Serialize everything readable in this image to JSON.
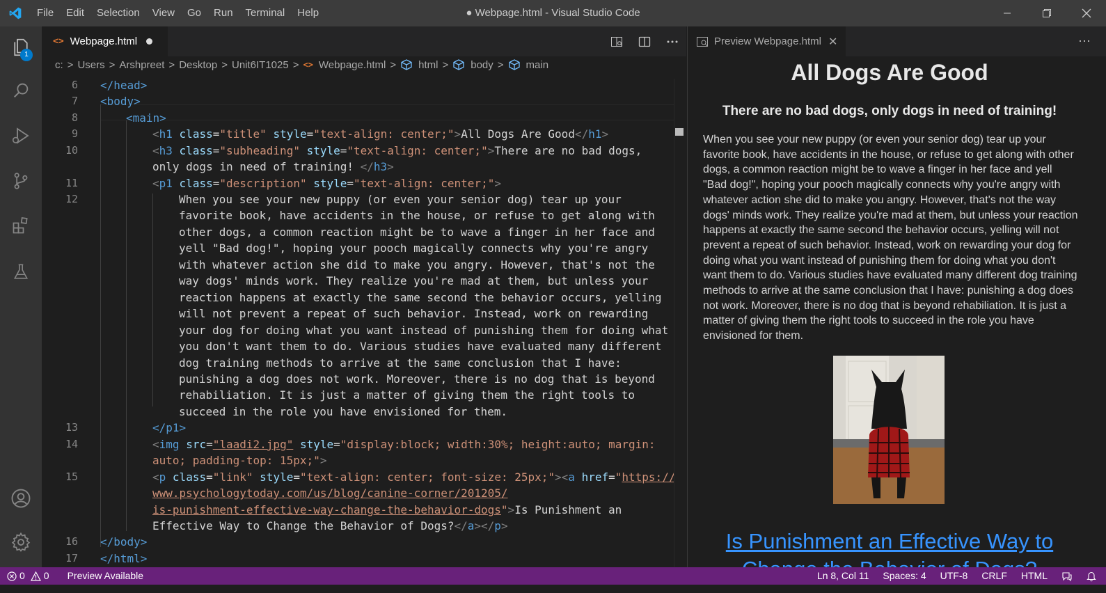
{
  "titlebar": {
    "menu": [
      "File",
      "Edit",
      "Selection",
      "View",
      "Go",
      "Run",
      "Terminal",
      "Help"
    ],
    "window_title": "● Webpage.html - Visual Studio Code"
  },
  "activity_bar": {
    "explorer_badge": "1"
  },
  "editor": {
    "tab_label": "Webpage.html",
    "breadcrumb": [
      "c:",
      "Users",
      "Arshpreet",
      "Desktop",
      "Unit6IT1025",
      "Webpage.html",
      "html",
      "body",
      "main"
    ],
    "line_numbers": [
      "6",
      "7",
      "8",
      "9",
      "10",
      "11",
      "12",
      "13",
      "14",
      "15",
      "16",
      "17"
    ],
    "code": {
      "l6_head_close": "</head>",
      "l7_body_open": "<body>",
      "l8_main_open": "<main>",
      "h1_class_val": "\"title\"",
      "h1_style_val": "\"text-align: center;\"",
      "h1_text": "All Dogs Are Good",
      "h3_class_val": "\"subheading\"",
      "h3_style_val": "\"text-align: center;\"",
      "h3_text_1": "There are no bad dogs,",
      "h3_text_2": "only dogs in need of training! ",
      "p1_class_val": "\"description\"",
      "p1_style_val": "\"text-align: center;\"",
      "desc_lines": [
        "When you see your new puppy (or even your senior dog) tear up your",
        "favorite book, have accidents in the house, or refuse to get along with",
        "other dogs, a common reaction might be to wave a finger in her face and",
        "yell \"Bad dog!\", hoping your pooch magically connects why you're angry",
        "with whatever action she did to make you angry. However, that's not the",
        "way dogs' minds work. They realize you're mad at them, but unless your",
        "reaction happens at exactly the same second the behavior occurs, yelling",
        "will not prevent a repeat of such behavior. Instead, work on rewarding",
        "your dog for doing what you want instead of punishing them for doing what",
        "you don't want them to do. Various studies have evaluated many different",
        "dog training methods to arrive at the same conclusion that I have:",
        "punishing a dog does not work. Moreover, there is no dog that is beyond",
        "rehabiliation. It is just a matter of giving them the right tools to",
        "succeed in the role you have envisioned for them."
      ],
      "p1_close": "</p1>",
      "img_src_val": "\"laadi2.jpg\"",
      "img_style_val_1": "\"display:block; width:30%; height:auto; margin:",
      "img_style_val_2": "auto; padding-top: 15px;\"",
      "p_class_val": "\"link\"",
      "p_style_val": "\"text-align: center; font-size: 25px;\"",
      "href_1": "https://",
      "href_2": "www.psychologytoday.com/us/blog/canine-corner/201205/",
      "href_3": "is-punishment-effective-way-change-the-behavior-dogs",
      "link_text_1": "Is Punishment an",
      "link_text_2": "Effective Way to Change the Behavior of Dogs?",
      "l16_body_close": "</body>",
      "l17_html_close": "</html>"
    }
  },
  "preview": {
    "tab_label": "Preview Webpage.html",
    "title": "All Dogs Are Good",
    "subheading": "There are no bad dogs, only dogs in need of training!",
    "description": "When you see your new puppy (or even your senior dog) tear up your favorite book, have accidents in the house, or refuse to get along with other dogs, a common reaction might be to wave a finger in her face and yell \"Bad dog!\", hoping your pooch magically connects why you're angry with whatever action she did to make you angry. However, that's not the way dogs' minds work. They realize you're mad at them, but unless your reaction happens at exactly the same second the behavior occurs, yelling will not prevent a repeat of such behavior. Instead, work on rewarding your dog for doing what you want instead of punishing them for doing what you don't want them to do. Various studies have evaluated many different dog training methods to arrive at the same conclusion that I have: punishing a dog does not work. Moreover, there is no dog that is beyond rehabiliation. It is just a matter of giving them the right tools to succeed in the role you have envisioned for them.",
    "link_text": "Is Punishment an Effective Way to Change the Behavior of Dogs?"
  },
  "statusbar": {
    "errors": "0",
    "warnings": "0",
    "preview_available": "Preview Available",
    "cursor": "Ln 8, Col 11",
    "spaces": "Spaces: 4",
    "encoding": "UTF-8",
    "eol": "CRLF",
    "language": "HTML"
  },
  "colors": {
    "statusbar": "#68217a",
    "titlebar": "#3c3c3c",
    "activitybar": "#333333",
    "editor_bg": "#1e1e1e",
    "link": "#3794ff",
    "accent": "#007acc"
  }
}
